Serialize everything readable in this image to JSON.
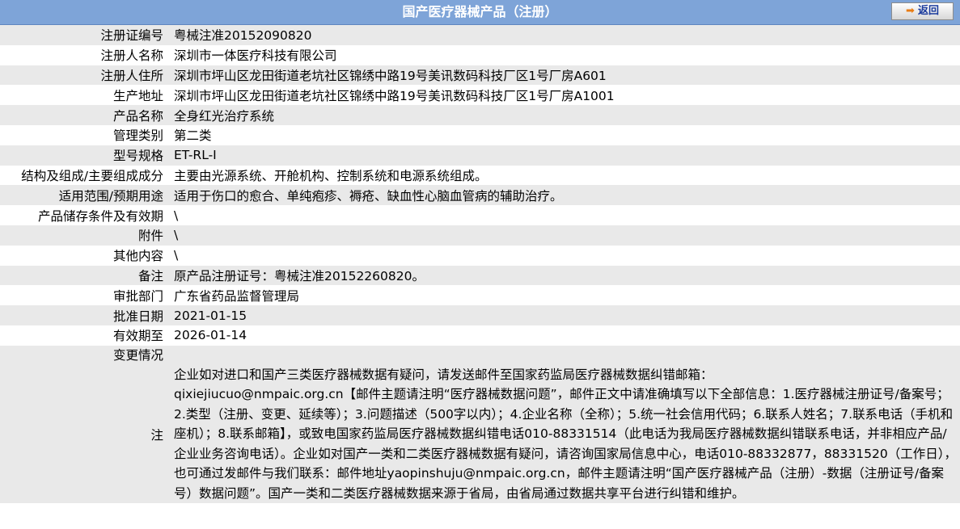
{
  "header": {
    "title": "国产医疗器械产品（注册）",
    "back_label": "返回",
    "back_icon": "right-arrow-icon"
  },
  "rows": [
    {
      "label": "注册证编号",
      "value": "粤械注准20152090820"
    },
    {
      "label": "注册人名称",
      "value": "深圳市一体医疗科技有限公司"
    },
    {
      "label": "注册人住所",
      "value": "深圳市坪山区龙田街道老坑社区锦绣中路19号美讯数码科技厂区1号厂房A601"
    },
    {
      "label": "生产地址",
      "value": "深圳市坪山区龙田街道老坑社区锦绣中路19号美讯数码科技厂区1号厂房A1001"
    },
    {
      "label": "产品名称",
      "value": "全身红光治疗系统"
    },
    {
      "label": "管理类别",
      "value": "第二类"
    },
    {
      "label": "型号规格",
      "value": "ET-RL-I"
    },
    {
      "label": "结构及组成/主要组成成分",
      "value": "主要由光源系统、开舱机构、控制系统和电源系统组成。"
    },
    {
      "label": "适用范围/预期用途",
      "value": "适用于伤口的愈合、单纯疱疹、褥疮、缺血性心脑血管病的辅助治疗。"
    },
    {
      "label": "产品储存条件及有效期",
      "value": "\\"
    },
    {
      "label": "附件",
      "value": "\\"
    },
    {
      "label": "其他内容",
      "value": "\\"
    },
    {
      "label": "备注",
      "value": "原产品注册证号：粤械注准20152260820。"
    },
    {
      "label": "审批部门",
      "value": "广东省药品监督管理局"
    },
    {
      "label": "批准日期",
      "value": "2021-01-15"
    },
    {
      "label": "有效期至",
      "value": "2026-01-14"
    }
  ],
  "change": {
    "label": "变更情况",
    "value": ""
  },
  "note": {
    "label": "注",
    "p1": "企业如对进口和国产三类医疗器械数据有疑问，请发送邮件至国家药监局医疗器械数据纠错邮箱：",
    "email1": "qixiejiucuo@nmpaic.org.cn",
    "p2": "【邮件主题请注明“医疗器械数据问题”，邮件正文中请准确填写以下全部信息：1.医疗器械注册证号/备案号； 2.类型（注册、变更、延续等）；3.问题描述（500字以内）；4.企业名称（全称）；5.统一社会信用代码；6.联系人姓名；7.联系电话（手机和座机）；8.联系邮箱】，或致电国家药监局医疗器械数据纠错电话010-88331514（此电话为我局医疗器械数据纠错联系电话，并非相应产品/企业业务咨询电话）。企业如对国产一类和二类医疗器械数据有疑问，请咨询国家局信息中心，电话010-88332877，88331520（工作日），也可通过发邮件与我们联系：邮件地址",
    "email2": "yaopinshuju@nmpaic.org.cn",
    "p3": "，邮件主题请注明“国产医疗器械产品（注册）-数据（注册证号/备案号）数据问题”。国产一类和二类医疗器械数据来源于省局，由省局通过数据共享平台进行纠错和维护。"
  }
}
